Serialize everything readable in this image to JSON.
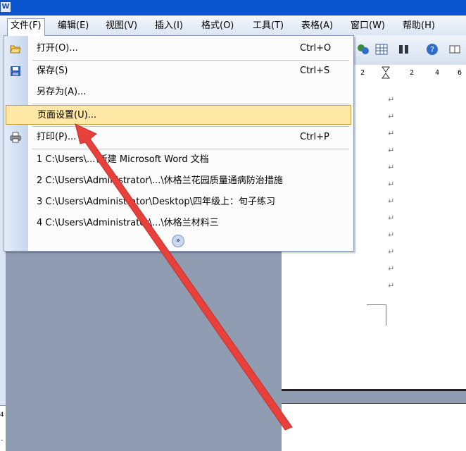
{
  "menubar": {
    "items": [
      {
        "label": "文件(F)"
      },
      {
        "label": "编辑(E)"
      },
      {
        "label": "视图(V)"
      },
      {
        "label": "插入(I)"
      },
      {
        "label": "格式(O)"
      },
      {
        "label": "工具(T)"
      },
      {
        "label": "表格(A)"
      },
      {
        "label": "窗口(W)"
      },
      {
        "label": "帮助(H)"
      }
    ]
  },
  "file_menu": {
    "open": {
      "label": "打开(O)...",
      "shortcut": "Ctrl+O",
      "icon": "open-folder-icon"
    },
    "save": {
      "label": "保存(S)",
      "shortcut": "Ctrl+S",
      "icon": "floppy-disk-icon"
    },
    "save_as": {
      "label": "另存为(A)..."
    },
    "page_setup": {
      "label": "页面设置(U)..."
    },
    "print": {
      "label": "打印(P)...",
      "shortcut": "Ctrl+P",
      "icon": "printer-icon"
    },
    "recent": [
      {
        "label": "1 C:\\Users\\...\\新建 Microsoft Word 文档"
      },
      {
        "label": "2 C:\\Users\\Administrator\\...\\休格兰花园质量通病防治措施"
      },
      {
        "label": "3 C:\\Users\\Administrator\\Desktop\\四年级上：句子练习"
      },
      {
        "label": "4 C:\\Users\\Administrator\\...\\休格兰材料三"
      }
    ],
    "expand_icon": "double-chevron-down-icon"
  },
  "ruler": {
    "ticks": [
      "2",
      "2",
      "4",
      "6"
    ]
  },
  "vertical_ruler": {
    "ticks": [
      "4",
      "-"
    ]
  },
  "colors": {
    "highlight": "#ffe8a6",
    "arrow": "#e8403a",
    "title_bar": "#0a55cf"
  }
}
